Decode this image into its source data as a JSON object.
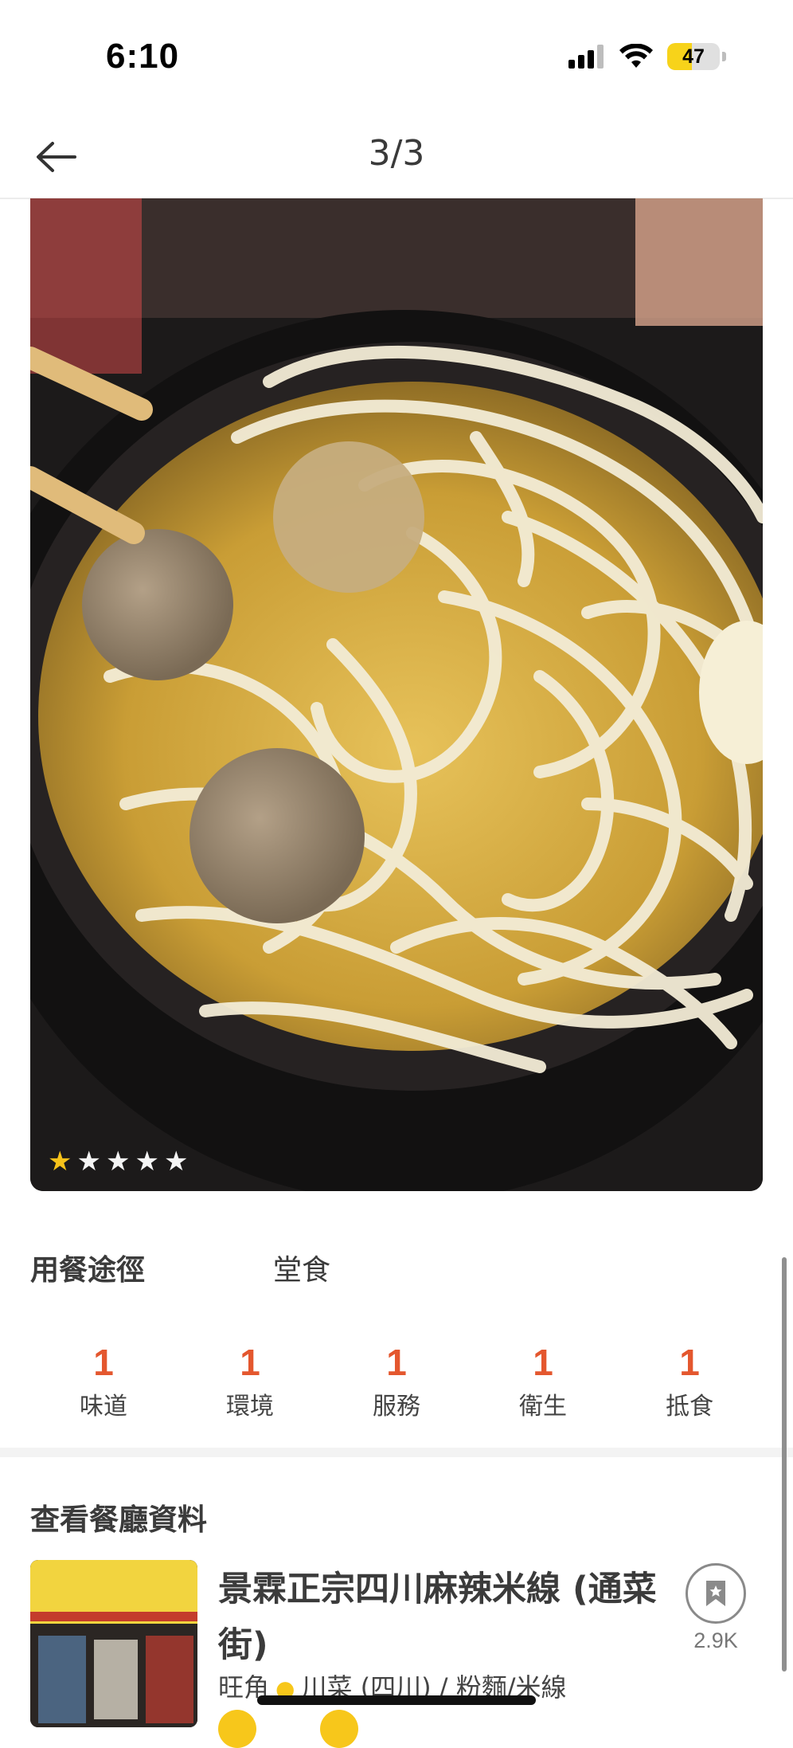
{
  "status_bar": {
    "time": "6:10",
    "battery": "47",
    "battery_level": 0.47
  },
  "nav": {
    "title": "3/3"
  },
  "photo": {
    "rating_stars": 1,
    "max_stars": 5
  },
  "dining": {
    "label": "用餐途徑",
    "value": "堂食"
  },
  "ratings": [
    {
      "score": "1",
      "label": "味道"
    },
    {
      "score": "1",
      "label": "環境"
    },
    {
      "score": "1",
      "label": "服務"
    },
    {
      "score": "1",
      "label": "衛生"
    },
    {
      "score": "1",
      "label": "抵食"
    }
  ],
  "restaurant_section": {
    "title": "查看餐廳資料",
    "name": "景霖正宗四川麻辣米線 (通菜街)",
    "district": "旺角",
    "cuisine": "川菜 (四川) / 粉麵/米線",
    "bookmark_count": "2.9K"
  },
  "colors": {
    "accent": "#e4572e",
    "star": "#f6c21a",
    "battery": "#f7d31a"
  }
}
